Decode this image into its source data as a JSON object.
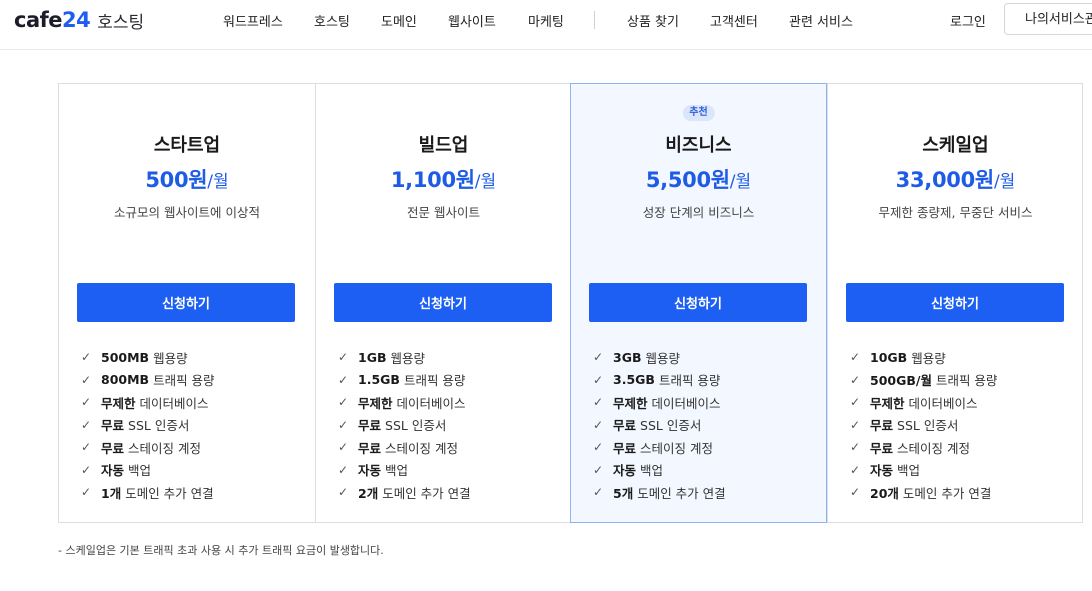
{
  "header": {
    "logo_mark_text": "cafe",
    "logo_mark_num": "24",
    "logo_sub": "호스팅",
    "nav": [
      {
        "label": "워드프레스",
        "id": "wordpress"
      },
      {
        "label": "호스팅",
        "id": "hosting"
      },
      {
        "label": "도메인",
        "id": "domain"
      },
      {
        "label": "웹사이트",
        "id": "website"
      },
      {
        "label": "마케팅",
        "id": "marketing"
      },
      {
        "label": "상품 찾기",
        "id": "find-product"
      },
      {
        "label": "고객센터",
        "id": "customer-center"
      },
      {
        "label": "관련 서비스",
        "id": "related-services"
      }
    ],
    "login_label": "로그인",
    "my_services_label": "나의서비스관리"
  },
  "plans": [
    {
      "name": "스타트업",
      "price": "500원",
      "unit": "/월",
      "desc": "소규모의 웹사이트에 이상적",
      "button": "신청하기",
      "features": [
        {
          "bold": "500MB",
          "text": "웹용량"
        },
        {
          "bold": "800MB",
          "text": "트래픽 용량"
        },
        {
          "bold": "무제한",
          "text": "데이터베이스"
        },
        {
          "bold": "무료",
          "text": "SSL 인증서"
        },
        {
          "bold": "무료",
          "text": "스테이징 계정"
        },
        {
          "bold": "자동",
          "text": "백업"
        },
        {
          "bold": "1개",
          "text": "도메인 추가 연결"
        }
      ]
    },
    {
      "name": "빌드업",
      "price": "1,100원",
      "unit": "/월",
      "desc": "전문 웹사이트",
      "button": "신청하기",
      "features": [
        {
          "bold": "1GB",
          "text": "웹용량"
        },
        {
          "bold": "1.5GB",
          "text": "트래픽 용량"
        },
        {
          "bold": "무제한",
          "text": "데이터베이스"
        },
        {
          "bold": "무료",
          "text": "SSL 인증서"
        },
        {
          "bold": "무료",
          "text": "스테이징 계정"
        },
        {
          "bold": "자동",
          "text": "백업"
        },
        {
          "bold": "2개",
          "text": "도메인 추가 연결"
        }
      ]
    },
    {
      "name": "비즈니스",
      "price": "5,500원",
      "unit": "/월",
      "desc": "성장 단계의 비즈니스",
      "button": "신청하기",
      "badge": "추천",
      "features": [
        {
          "bold": "3GB",
          "text": "웹용량"
        },
        {
          "bold": "3.5GB",
          "text": "트래픽 용량"
        },
        {
          "bold": "무제한",
          "text": "데이터베이스"
        },
        {
          "bold": "무료",
          "text": "SSL 인증서"
        },
        {
          "bold": "무료",
          "text": "스테이징 계정"
        },
        {
          "bold": "자동",
          "text": "백업"
        },
        {
          "bold": "5개",
          "text": "도메인 추가 연결"
        }
      ]
    },
    {
      "name": "스케일업",
      "price": "33,000원",
      "unit": "/월",
      "desc": "무제한 종량제, 무중단 서비스",
      "button": "신청하기",
      "features": [
        {
          "bold": "10GB",
          "text": "웹용량"
        },
        {
          "bold": "500GB/월",
          "text": "트래픽 용량"
        },
        {
          "bold": "무제한",
          "text": "데이터베이스"
        },
        {
          "bold": "무료",
          "text": "SSL 인증서"
        },
        {
          "bold": "무료",
          "text": "스테이징 계정"
        },
        {
          "bold": "자동",
          "text": "백업"
        },
        {
          "bold": "20개",
          "text": "도메인 추가 연결"
        }
      ]
    }
  ],
  "footnote": "- 스케일업은 기본 트래픽 초과 사용 시 추가 트래픽 요금이 발생합니다.",
  "colors": {
    "accent": "#1d5ff2",
    "price": "#1f5ce6",
    "recommended_bg": "#f3f7ff"
  }
}
